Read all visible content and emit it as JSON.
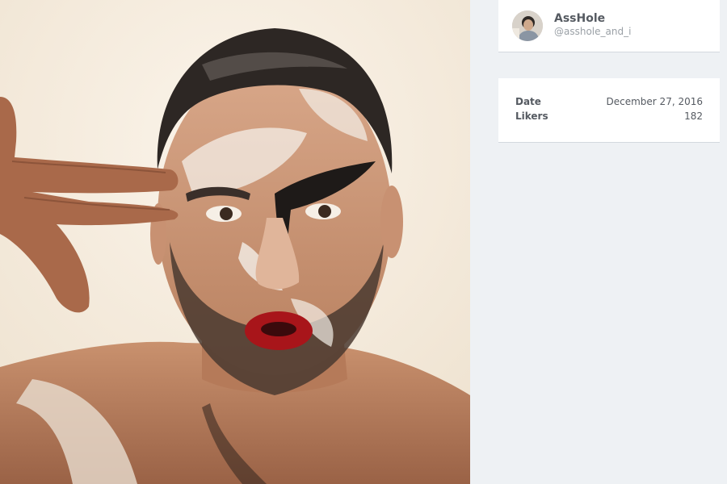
{
  "post": {
    "image_subject": "portrait-photo"
  },
  "profile": {
    "name": "AssHole",
    "handle": "@asshole_and_i"
  },
  "stats": [
    {
      "label": "Date",
      "value": "December 27, 2016"
    },
    {
      "label": "Likers",
      "value": "182"
    }
  ],
  "colors": {
    "sidebar_bg": "#eef1f4",
    "card_bg": "#ffffff",
    "text": "#555a61",
    "muted_text": "#9aa0a6"
  }
}
